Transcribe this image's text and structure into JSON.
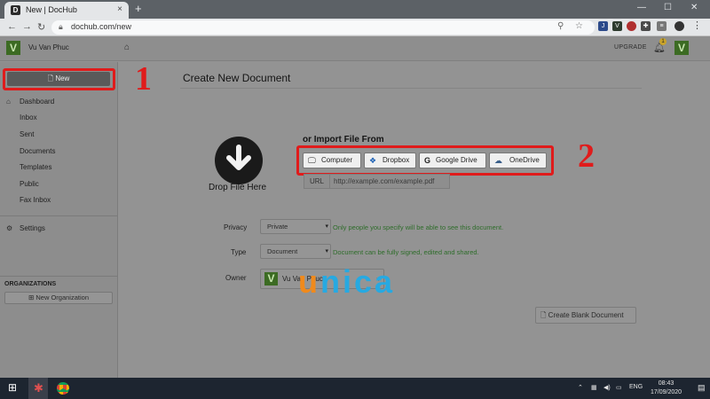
{
  "browser": {
    "tab_title": "New | DocHub",
    "tab_favicon": "D",
    "tab_close": "×",
    "new_tab": "+",
    "win_min": "—",
    "win_max": "☐",
    "win_close": "✕",
    "url": "dochub.com/new"
  },
  "header": {
    "user_name": "Vu Van Phuc",
    "logo_letter": "V",
    "upgrade_label": "UPGRADE",
    "notification_count": "1"
  },
  "sidebar": {
    "new_label": "New",
    "items": [
      {
        "label": "Dashboard"
      },
      {
        "label": "Inbox"
      },
      {
        "label": "Sent"
      },
      {
        "label": "Documents"
      },
      {
        "label": "Templates"
      },
      {
        "label": "Public"
      },
      {
        "label": "Fax Inbox"
      }
    ],
    "settings_label": "Settings",
    "org_title": "ORGANIZATIONS",
    "new_org_label": "New Organization"
  },
  "main": {
    "title": "Create New Document",
    "drop_label": "Drop File Here",
    "import_label": "or Import File From",
    "import_buttons": [
      {
        "label": "Computer",
        "icon": "monitor-icon"
      },
      {
        "label": "Dropbox",
        "icon": "dropbox-icon"
      },
      {
        "label": "Google Drive",
        "icon": "google-icon"
      },
      {
        "label": "OneDrive",
        "icon": "onedrive-icon"
      }
    ],
    "url_label": "URL",
    "url_placeholder": "http://example.com/example.pdf",
    "privacy_label": "Privacy",
    "privacy_value": "Private",
    "privacy_note": "Only people you specify will be able to see this document.",
    "type_label": "Type",
    "type_value": "Document",
    "type_note": "Document can be fully signed, edited and shared.",
    "owner_label": "Owner",
    "owner_value": "Vu Van Phuc",
    "blank_label": "Create Blank Document"
  },
  "annotations": {
    "step1": "1",
    "step2": "2",
    "color": "#e01b1b"
  },
  "watermark": {
    "text": "unica",
    "colors": [
      "#f08a1c",
      "#27a9e1"
    ]
  },
  "taskbar": {
    "lang": "ENG",
    "time": "08:43",
    "date": "17/09/2020"
  }
}
